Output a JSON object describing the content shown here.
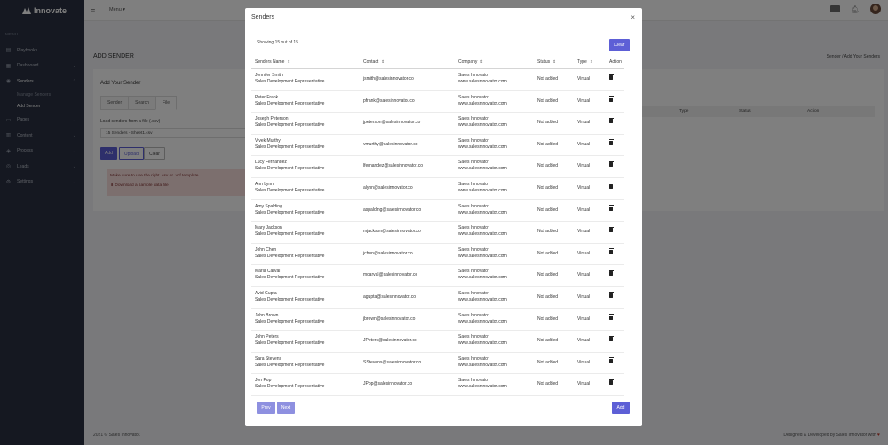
{
  "brand": {
    "name": "Innovate"
  },
  "sidebar": {
    "caption": "MENU",
    "items": [
      {
        "label": "Playbooks",
        "icon": "book-icon"
      },
      {
        "label": "Dashboard",
        "icon": "dashboard-icon"
      },
      {
        "label": "Senders",
        "icon": "users-icon"
      },
      {
        "label": "Pages",
        "icon": "pages-icon"
      },
      {
        "label": "Content",
        "icon": "content-icon"
      },
      {
        "label": "Process",
        "icon": "process-icon"
      },
      {
        "label": "Leads",
        "icon": "leads-icon"
      },
      {
        "label": "Settings",
        "icon": "gear-icon"
      }
    ],
    "sub_items": [
      "Manage Senders",
      "Add Sender"
    ]
  },
  "topbar": {
    "menu_label": "Menu"
  },
  "page": {
    "title": "ADD SENDER",
    "breadcrumb": "Sender / Add Your Senders",
    "card_title": "Add Your Sender",
    "tabs": [
      "Sender",
      "Search",
      "File"
    ],
    "load_label": "Load senders from a file (.csv)",
    "file_value": "15 Senders - Sheet1.csv",
    "buttons": {
      "add": "Add",
      "upload": "Upload",
      "clear": "Clear"
    },
    "note": "Make sure to use the right .csv or .vcf template",
    "download_link": "Download a sample data file",
    "table_headers": {
      "type": "Type",
      "status": "Status",
      "action": "Action"
    }
  },
  "footer": {
    "left": "2021 © Sales Innovator.",
    "right_prefix": "Designed & Developed by",
    "right_brand": "Sales Innovator",
    "right_suffix": "with"
  },
  "modal": {
    "title": "Senders",
    "showing": "Showing 15 out of 15.",
    "clear_label": "Clear",
    "columns": {
      "name": "Senders Name",
      "contact": "Contact",
      "company": "Company",
      "status": "Status",
      "type": "Type",
      "action": "Action"
    },
    "rows": [
      {
        "name": "Jennifer Smith",
        "title": "Sales Development Representative",
        "contact": "jsmith@salesinnovator.co",
        "company": "Sales Innovator",
        "website": "www.salesinnovator.com",
        "status": "Not added",
        "type": "Virtual"
      },
      {
        "name": "Peter Frank",
        "title": "Sales Development Representative",
        "contact": "pfrank@salesinnovator.co",
        "company": "Sales Innovator",
        "website": "www.salesinnovator.com",
        "status": "Not added",
        "type": "Virtual"
      },
      {
        "name": "Joseph Peterson",
        "title": "Sales Development Representative",
        "contact": "jpeterson@salesinnovator.co",
        "company": "Sales Innovator",
        "website": "www.salesinnovator.com",
        "status": "Not added",
        "type": "Virtual"
      },
      {
        "name": "Vivek Murthy",
        "title": "Sales Development Representative",
        "contact": "vmurthy@salesinnovator.co",
        "company": "Sales Innovator",
        "website": "www.salesinnovator.com",
        "status": "Not added",
        "type": "Virtual"
      },
      {
        "name": "Lucy Fernandez",
        "title": "Sales Development Representative",
        "contact": "lfernandez@salesinnovator.co",
        "company": "Sales Innovator",
        "website": "www.salesinnovator.com",
        "status": "Not added",
        "type": "Virtual"
      },
      {
        "name": "Ann Lynn",
        "title": "Sales Development Representative",
        "contact": "alynn@salesinnovator.co",
        "company": "Sales Innovator",
        "website": "www.salesinnovator.com",
        "status": "Not added",
        "type": "Virtual"
      },
      {
        "name": "Amy Spalding",
        "title": "Sales Development Representative",
        "contact": "aspalding@salesinnovator.co",
        "company": "Sales Innovator",
        "website": "www.salesinnovator.com",
        "status": "Not added",
        "type": "Virtual"
      },
      {
        "name": "Mary Jackson",
        "title": "Sales Development Representative",
        "contact": "mjackson@salesinnovator.co",
        "company": "Sales Innovator",
        "website": "www.salesinnovator.com",
        "status": "Not added",
        "type": "Virtual"
      },
      {
        "name": "John Chen",
        "title": "Sales Development Representative",
        "contact": "jchen@salesinnovator.co",
        "company": "Sales Innovator",
        "website": "www.salesinnovator.com",
        "status": "Not added",
        "type": "Virtual"
      },
      {
        "name": "Maria Carval",
        "title": "Sales Development Representative",
        "contact": "mcarval@salesinnovator.co",
        "company": "Sales Innovator",
        "website": "www.salesinnovator.com",
        "status": "Not added",
        "type": "Virtual"
      },
      {
        "name": "Avid Gupta",
        "title": "Sales Development Representative",
        "contact": "agupta@salesinnovator.co",
        "company": "Sales Innovator",
        "website": "www.salesinnovator.com",
        "status": "Not added",
        "type": "Virtual"
      },
      {
        "name": "John Brown",
        "title": "Sales Development Representative",
        "contact": "jbrown@salesinnovator.co",
        "company": "Sales Innovator",
        "website": "www.salesinnovator.com",
        "status": "Not added",
        "type": "Virtual"
      },
      {
        "name": "John Peters",
        "title": "Sales Development Representative",
        "contact": "JPeters@salesinnovator.co",
        "company": "Sales Innovator",
        "website": "www.salesinnovator.com",
        "status": "Not added",
        "type": "Virtual"
      },
      {
        "name": "Sara Stevens",
        "title": "Sales Development Representative",
        "contact": "SStevens@salesinnovator.co",
        "company": "Sales Innovator",
        "website": "www.salesinnovator.com",
        "status": "Not added",
        "type": "Virtual"
      },
      {
        "name": "Jen Pop",
        "title": "Sales Development Representative",
        "contact": "JPop@salesinnovator.co",
        "company": "Sales Innovator",
        "website": "www.salesinnovator.com",
        "status": "Not added",
        "type": "Virtual"
      }
    ],
    "prev_label": "Prev",
    "next_label": "Next",
    "add_label": "Add"
  },
  "colors": {
    "primary": "#5d5fd6",
    "sidebar": "#2a3142",
    "disabled": "#8e90e0"
  }
}
